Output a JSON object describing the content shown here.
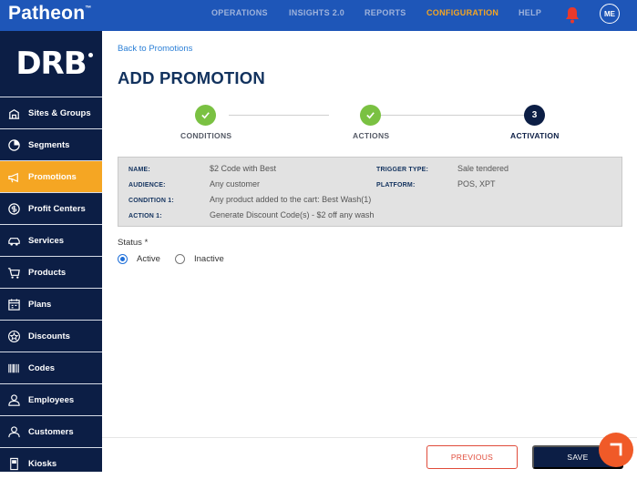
{
  "brand": {
    "name": "Patheon",
    "mark": "™"
  },
  "nav": {
    "items": [
      {
        "label": "OPERATIONS"
      },
      {
        "label": "INSIGHTS 2.0"
      },
      {
        "label": "REPORTS"
      },
      {
        "label": "CONFIGURATION",
        "active": true
      },
      {
        "label": "HELP"
      }
    ],
    "avatar_initials": "ME",
    "bell_icon": "bell-icon"
  },
  "sidebar": {
    "logo": "DRB",
    "items": [
      {
        "label": "Sites & Groups",
        "icon": "building-icon"
      },
      {
        "label": "Segments",
        "icon": "pie-chart-icon"
      },
      {
        "label": "Promotions",
        "icon": "megaphone-icon",
        "active": true
      },
      {
        "label": "Profit Centers",
        "icon": "dollar-circle-icon"
      },
      {
        "label": "Services",
        "icon": "car-icon"
      },
      {
        "label": "Products",
        "icon": "cart-icon"
      },
      {
        "label": "Plans",
        "icon": "calendar-icon"
      },
      {
        "label": "Discounts",
        "icon": "star-badge-icon"
      },
      {
        "label": "Codes",
        "icon": "barcode-icon"
      },
      {
        "label": "Employees",
        "icon": "person-badge-icon"
      },
      {
        "label": "Customers",
        "icon": "person-icon"
      },
      {
        "label": "Kiosks",
        "icon": "kiosk-icon"
      }
    ]
  },
  "main": {
    "back_link": "Back to Promotions",
    "title": "ADD PROMOTION",
    "steps": [
      {
        "label": "CONDITIONS",
        "state": "done"
      },
      {
        "label": "ACTIONS",
        "state": "done"
      },
      {
        "label": "ACTIVATION",
        "state": "current",
        "number": "3"
      }
    ],
    "summary": {
      "name_key": "NAME:",
      "name_val": "$2 Code with Best",
      "audience_key": "AUDIENCE:",
      "audience_val": "Any customer",
      "condition_key": "CONDITION 1:",
      "condition_val": "Any product added to the cart: Best Wash(1)",
      "action_key": "ACTION 1:",
      "action_val": "Generate Discount Code(s) - $2 off any wash",
      "trigger_key": "TRIGGER TYPE:",
      "trigger_val": "Sale tendered",
      "platform_key": "PLATFORM:",
      "platform_val": "POS, XPT"
    },
    "status": {
      "label": "Status *",
      "options": [
        {
          "label": "Active",
          "selected": true
        },
        {
          "label": "Inactive",
          "selected": false
        }
      ]
    },
    "buttons": {
      "previous": "PREVIOUS",
      "save": "SAVE"
    }
  },
  "colors": {
    "topbar": "#1e56b8",
    "sidebar": "#0c1e45",
    "accent": "#f5a623",
    "success": "#7ac142",
    "danger": "#e04b3a",
    "chat": "#f05a28"
  }
}
